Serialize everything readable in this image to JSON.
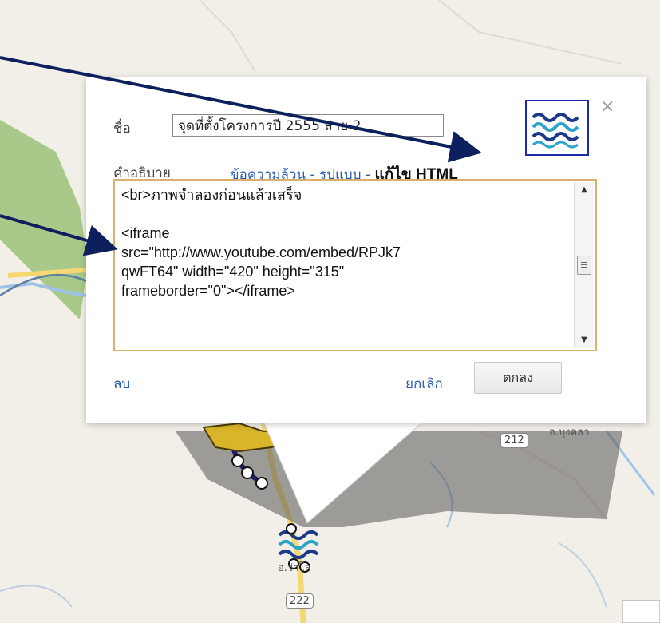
{
  "map": {
    "route_shields": [
      "212",
      "222"
    ],
    "place_labels": [
      "อ.บุงคลา",
      "อ.ว่าโล"
    ],
    "colors": {
      "background": "#f2efe9",
      "forest": "#a8c98a",
      "road": "#f3d873",
      "river": "#9fc2e6",
      "route": "#1d1d6b"
    }
  },
  "popup": {
    "name_label": "ชื่อ",
    "name_value": "จุดที่ตั้งโครงการปี 2555 สาย 2",
    "description_label": "คำอธิบาย",
    "modes": {
      "plain_text": "ข้อความล้วน",
      "separator": " - ",
      "rich_text": "รูปแบบ",
      "edit_html": "แก้ไข HTML"
    },
    "description_value": "<br>ภาพจำลองก่อนแล้วเสร็จ\n\n<iframe\nsrc=\"http://www.youtube.com/embed/RPJk7\nqwFT64\" width=\"420\" height=\"315\"\nframeborder=\"0\"></iframe>",
    "delete_label": "ลบ",
    "cancel_label": "ยกเลิก",
    "ok_label": "ตกลง",
    "close_glyph": "×",
    "marker_icon": "water-waves-icon"
  },
  "annotations": {
    "arrow_color": "#0d1f5c",
    "count": 2
  }
}
